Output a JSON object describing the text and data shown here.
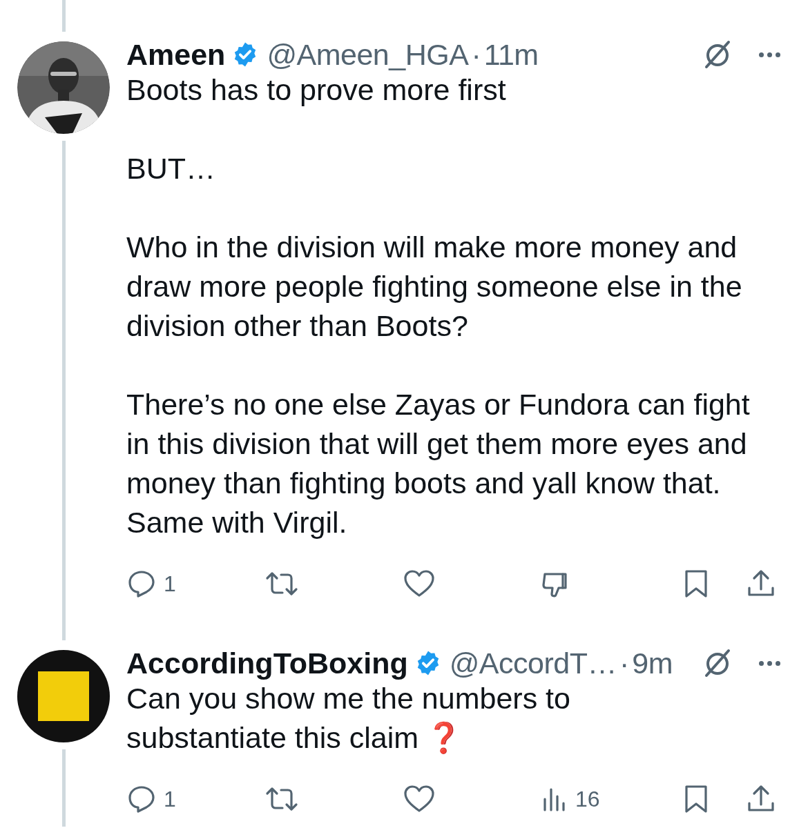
{
  "thread_above": true,
  "tweets": [
    {
      "name": "Ameen",
      "verified": true,
      "handle": "@Ameen_HGA",
      "separator": "·",
      "time": "11m",
      "thread_below": true,
      "paragraphs": [
        "Boots has to prove more first",
        "BUT…",
        "Who in the division will make more money and draw more people fighting someone else in the division other than Boots?",
        "There’s no one else Zayas or Fundora can fight in this division that will get them more eyes and money than fighting boots and yall know that. Same with Virgil."
      ],
      "actions": [
        {
          "kind": "reply",
          "count": "1"
        },
        {
          "kind": "repost"
        },
        {
          "kind": "like"
        },
        {
          "kind": "dislike"
        },
        {
          "kind": "bookmark"
        },
        {
          "kind": "share"
        }
      ]
    },
    {
      "name": "AccordingToBoxing",
      "verified": true,
      "handle": "@AccordT…",
      "separator": "·",
      "time": "9m",
      "thread_below": true,
      "paragraphs": [
        "Can you show me the numbers to substantiate this claim"
      ],
      "emoji": "❓",
      "actions": [
        {
          "kind": "reply",
          "count": "1"
        },
        {
          "kind": "repost"
        },
        {
          "kind": "like"
        },
        {
          "kind": "views",
          "count": "16"
        },
        {
          "kind": "bookmark"
        },
        {
          "kind": "share"
        }
      ]
    }
  ]
}
